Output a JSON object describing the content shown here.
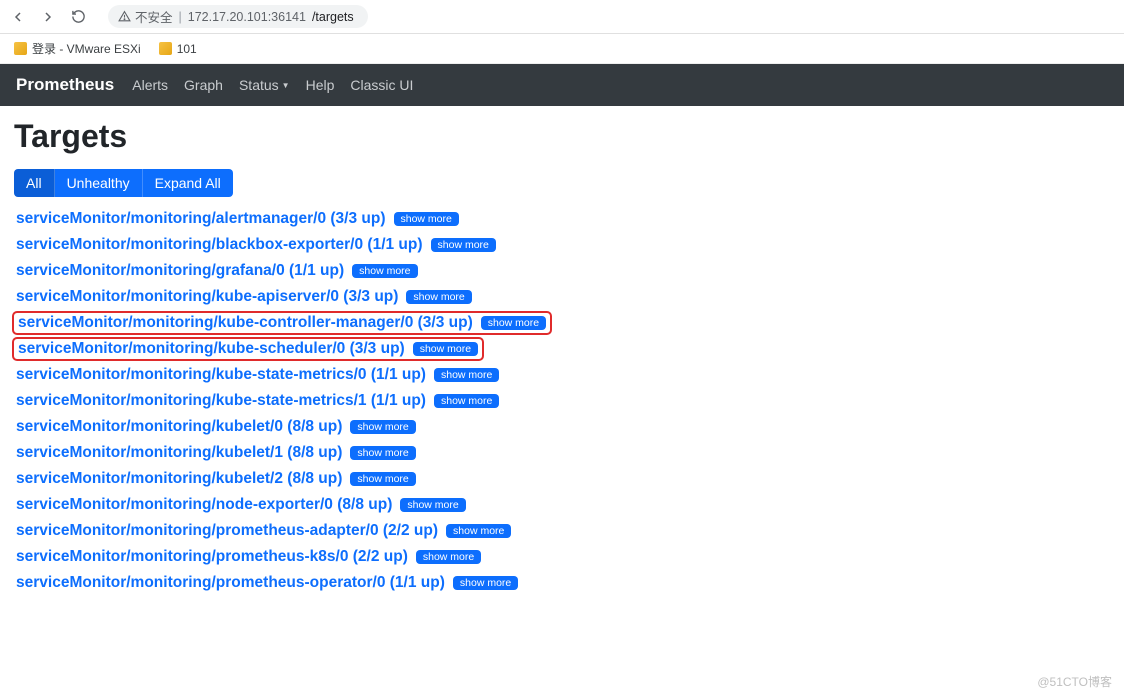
{
  "browser": {
    "security_label": "不安全",
    "host": "172.17.20.101:36141",
    "path": "/targets"
  },
  "bookmarks": [
    {
      "label": "登录 - VMware ESXi"
    },
    {
      "label": "101"
    }
  ],
  "navbar": {
    "brand": "Prometheus",
    "links": [
      {
        "label": "Alerts",
        "dropdown": false
      },
      {
        "label": "Graph",
        "dropdown": false
      },
      {
        "label": "Status",
        "dropdown": true
      },
      {
        "label": "Help",
        "dropdown": false
      },
      {
        "label": "Classic UI",
        "dropdown": false
      }
    ]
  },
  "page": {
    "title": "Targets",
    "filters": {
      "all": "All",
      "unhealthy": "Unhealthy",
      "expand_all": "Expand All"
    },
    "show_more_label": "show more"
  },
  "targets": [
    {
      "name": "serviceMonitor/monitoring/alertmanager/0",
      "status": "(3/3 up)",
      "highlight": false
    },
    {
      "name": "serviceMonitor/monitoring/blackbox-exporter/0",
      "status": "(1/1 up)",
      "highlight": false
    },
    {
      "name": "serviceMonitor/monitoring/grafana/0",
      "status": "(1/1 up)",
      "highlight": false
    },
    {
      "name": "serviceMonitor/monitoring/kube-apiserver/0",
      "status": "(3/3 up)",
      "highlight": false
    },
    {
      "name": "serviceMonitor/monitoring/kube-controller-manager/0",
      "status": "(3/3 up)",
      "highlight": true
    },
    {
      "name": "serviceMonitor/monitoring/kube-scheduler/0",
      "status": "(3/3 up)",
      "highlight": true
    },
    {
      "name": "serviceMonitor/monitoring/kube-state-metrics/0",
      "status": "(1/1 up)",
      "highlight": false
    },
    {
      "name": "serviceMonitor/monitoring/kube-state-metrics/1",
      "status": "(1/1 up)",
      "highlight": false
    },
    {
      "name": "serviceMonitor/monitoring/kubelet/0",
      "status": "(8/8 up)",
      "highlight": false
    },
    {
      "name": "serviceMonitor/monitoring/kubelet/1",
      "status": "(8/8 up)",
      "highlight": false
    },
    {
      "name": "serviceMonitor/monitoring/kubelet/2",
      "status": "(8/8 up)",
      "highlight": false
    },
    {
      "name": "serviceMonitor/monitoring/node-exporter/0",
      "status": "(8/8 up)",
      "highlight": false
    },
    {
      "name": "serviceMonitor/monitoring/prometheus-adapter/0",
      "status": "(2/2 up)",
      "highlight": false
    },
    {
      "name": "serviceMonitor/monitoring/prometheus-k8s/0",
      "status": "(2/2 up)",
      "highlight": false
    },
    {
      "name": "serviceMonitor/monitoring/prometheus-operator/0",
      "status": "(1/1 up)",
      "highlight": false
    }
  ],
  "watermark": "@51CTO博客"
}
